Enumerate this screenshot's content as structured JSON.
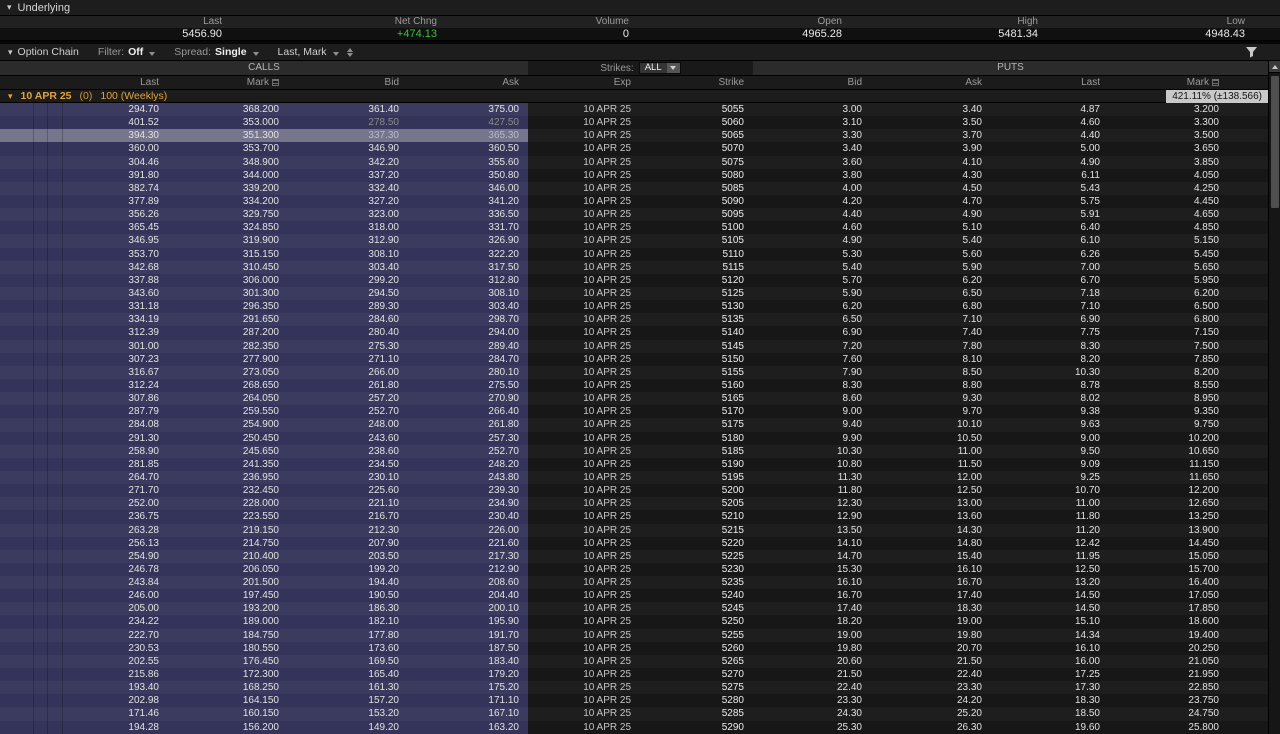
{
  "underlying": {
    "section_label": "Underlying",
    "fields": [
      {
        "label": "Last",
        "value": "5456.90"
      },
      {
        "label": "Net Chng",
        "value": "+474.13"
      },
      {
        "label": "Volume",
        "value": "0"
      },
      {
        "label": "Open",
        "value": "4965.28"
      },
      {
        "label": "High",
        "value": "5481.34"
      },
      {
        "label": "Low",
        "value": "4948.43"
      }
    ]
  },
  "toolbar": {
    "title": "Option Chain",
    "filter_label": "Filter:",
    "filter_value": "Off",
    "spread_label": "Spread:",
    "spread_value": "Single",
    "columns_value": "Last, Mark"
  },
  "chain_header": {
    "calls_label": "CALLS",
    "strikes_label": "Strikes:",
    "strikes_value": "ALL",
    "puts_label": "PUTS"
  },
  "columns": {
    "calls": [
      "Last",
      "Mark",
      "Bid",
      "Ask"
    ],
    "middle": [
      "Exp",
      "Strike"
    ],
    "puts": [
      "Bid",
      "Ask",
      "Last",
      "Mark"
    ]
  },
  "group_row": {
    "expiry": "10 APR 25",
    "days": "(0)",
    "series": "100 (Weeklys)",
    "iv": "421.11% (±138.566)"
  },
  "selected_row_index": 2,
  "stale_row_index": 1,
  "colors": {
    "accent_orange": "#e2a33d",
    "positive_green": "#3fbf3f",
    "calls_itm_bg": "#3b3b60",
    "selected_row_bg": "#75758c",
    "iv_chip_bg": "#c9c9c9"
  },
  "chain_rows": [
    [
      "294.70",
      "368.200",
      "361.40",
      "375.00",
      "10 APR 25",
      "5055",
      "3.00",
      "3.40",
      "4.87",
      "3.200"
    ],
    [
      "401.52",
      "353.000",
      "278.50",
      "427.50",
      "10 APR 25",
      "5060",
      "3.10",
      "3.50",
      "4.60",
      "3.300"
    ],
    [
      "394.30",
      "351.300",
      "337.30",
      "365.30",
      "10 APR 25",
      "5065",
      "3.30",
      "3.70",
      "4.40",
      "3.500"
    ],
    [
      "360.00",
      "353.700",
      "346.90",
      "360.50",
      "10 APR 25",
      "5070",
      "3.40",
      "3.90",
      "5.00",
      "3.650"
    ],
    [
      "304.46",
      "348.900",
      "342.20",
      "355.60",
      "10 APR 25",
      "5075",
      "3.60",
      "4.10",
      "4.90",
      "3.850"
    ],
    [
      "391.80",
      "344.000",
      "337.20",
      "350.80",
      "10 APR 25",
      "5080",
      "3.80",
      "4.30",
      "6.11",
      "4.050"
    ],
    [
      "382.74",
      "339.200",
      "332.40",
      "346.00",
      "10 APR 25",
      "5085",
      "4.00",
      "4.50",
      "5.43",
      "4.250"
    ],
    [
      "377.89",
      "334.200",
      "327.20",
      "341.20",
      "10 APR 25",
      "5090",
      "4.20",
      "4.70",
      "5.75",
      "4.450"
    ],
    [
      "356.26",
      "329.750",
      "323.00",
      "336.50",
      "10 APR 25",
      "5095",
      "4.40",
      "4.90",
      "5.91",
      "4.650"
    ],
    [
      "365.45",
      "324.850",
      "318.00",
      "331.70",
      "10 APR 25",
      "5100",
      "4.60",
      "5.10",
      "6.40",
      "4.850"
    ],
    [
      "346.95",
      "319.900",
      "312.90",
      "326.90",
      "10 APR 25",
      "5105",
      "4.90",
      "5.40",
      "6.10",
      "5.150"
    ],
    [
      "353.70",
      "315.150",
      "308.10",
      "322.20",
      "10 APR 25",
      "5110",
      "5.30",
      "5.60",
      "6.26",
      "5.450"
    ],
    [
      "342.68",
      "310.450",
      "303.40",
      "317.50",
      "10 APR 25",
      "5115",
      "5.40",
      "5.90",
      "7.00",
      "5.650"
    ],
    [
      "337.88",
      "306.000",
      "299.20",
      "312.80",
      "10 APR 25",
      "5120",
      "5.70",
      "6.20",
      "6.70",
      "5.950"
    ],
    [
      "343.60",
      "301.300",
      "294.50",
      "308.10",
      "10 APR 25",
      "5125",
      "5.90",
      "6.50",
      "7.18",
      "6.200"
    ],
    [
      "331.18",
      "296.350",
      "289.30",
      "303.40",
      "10 APR 25",
      "5130",
      "6.20",
      "6.80",
      "7.10",
      "6.500"
    ],
    [
      "334.19",
      "291.650",
      "284.60",
      "298.70",
      "10 APR 25",
      "5135",
      "6.50",
      "7.10",
      "6.90",
      "6.800"
    ],
    [
      "312.39",
      "287.200",
      "280.40",
      "294.00",
      "10 APR 25",
      "5140",
      "6.90",
      "7.40",
      "7.75",
      "7.150"
    ],
    [
      "301.00",
      "282.350",
      "275.30",
      "289.40",
      "10 APR 25",
      "5145",
      "7.20",
      "7.80",
      "8.30",
      "7.500"
    ],
    [
      "307.23",
      "277.900",
      "271.10",
      "284.70",
      "10 APR 25",
      "5150",
      "7.60",
      "8.10",
      "8.20",
      "7.850"
    ],
    [
      "316.67",
      "273.050",
      "266.00",
      "280.10",
      "10 APR 25",
      "5155",
      "7.90",
      "8.50",
      "10.30",
      "8.200"
    ],
    [
      "312.24",
      "268.650",
      "261.80",
      "275.50",
      "10 APR 25",
      "5160",
      "8.30",
      "8.80",
      "8.78",
      "8.550"
    ],
    [
      "307.86",
      "264.050",
      "257.20",
      "270.90",
      "10 APR 25",
      "5165",
      "8.60",
      "9.30",
      "8.02",
      "8.950"
    ],
    [
      "287.79",
      "259.550",
      "252.70",
      "266.40",
      "10 APR 25",
      "5170",
      "9.00",
      "9.70",
      "9.38",
      "9.350"
    ],
    [
      "284.08",
      "254.900",
      "248.00",
      "261.80",
      "10 APR 25",
      "5175",
      "9.40",
      "10.10",
      "9.63",
      "9.750"
    ],
    [
      "291.30",
      "250.450",
      "243.60",
      "257.30",
      "10 APR 25",
      "5180",
      "9.90",
      "10.50",
      "9.00",
      "10.200"
    ],
    [
      "258.90",
      "245.650",
      "238.60",
      "252.70",
      "10 APR 25",
      "5185",
      "10.30",
      "11.00",
      "9.50",
      "10.650"
    ],
    [
      "281.85",
      "241.350",
      "234.50",
      "248.20",
      "10 APR 25",
      "5190",
      "10.80",
      "11.50",
      "9.09",
      "11.150"
    ],
    [
      "264.70",
      "236.950",
      "230.10",
      "243.80",
      "10 APR 25",
      "5195",
      "11.30",
      "12.00",
      "9.25",
      "11.650"
    ],
    [
      "271.70",
      "232.450",
      "225.60",
      "239.30",
      "10 APR 25",
      "5200",
      "11.80",
      "12.50",
      "10.70",
      "12.200"
    ],
    [
      "252.00",
      "228.000",
      "221.10",
      "234.90",
      "10 APR 25",
      "5205",
      "12.30",
      "13.00",
      "11.00",
      "12.650"
    ],
    [
      "236.75",
      "223.550",
      "216.70",
      "230.40",
      "10 APR 25",
      "5210",
      "12.90",
      "13.60",
      "11.80",
      "13.250"
    ],
    [
      "263.28",
      "219.150",
      "212.30",
      "226.00",
      "10 APR 25",
      "5215",
      "13.50",
      "14.30",
      "11.20",
      "13.900"
    ],
    [
      "256.13",
      "214.750",
      "207.90",
      "221.60",
      "10 APR 25",
      "5220",
      "14.10",
      "14.80",
      "12.42",
      "14.450"
    ],
    [
      "254.90",
      "210.400",
      "203.50",
      "217.30",
      "10 APR 25",
      "5225",
      "14.70",
      "15.40",
      "11.95",
      "15.050"
    ],
    [
      "246.78",
      "206.050",
      "199.20",
      "212.90",
      "10 APR 25",
      "5230",
      "15.30",
      "16.10",
      "12.50",
      "15.700"
    ],
    [
      "243.84",
      "201.500",
      "194.40",
      "208.60",
      "10 APR 25",
      "5235",
      "16.10",
      "16.70",
      "13.20",
      "16.400"
    ],
    [
      "246.00",
      "197.450",
      "190.50",
      "204.40",
      "10 APR 25",
      "5240",
      "16.70",
      "17.40",
      "14.50",
      "17.050"
    ],
    [
      "205.00",
      "193.200",
      "186.30",
      "200.10",
      "10 APR 25",
      "5245",
      "17.40",
      "18.30",
      "14.50",
      "17.850"
    ],
    [
      "234.22",
      "189.000",
      "182.10",
      "195.90",
      "10 APR 25",
      "5250",
      "18.20",
      "19.00",
      "15.10",
      "18.600"
    ],
    [
      "222.70",
      "184.750",
      "177.80",
      "191.70",
      "10 APR 25",
      "5255",
      "19.00",
      "19.80",
      "14.34",
      "19.400"
    ],
    [
      "230.53",
      "180.550",
      "173.60",
      "187.50",
      "10 APR 25",
      "5260",
      "19.80",
      "20.70",
      "16.10",
      "20.250"
    ],
    [
      "202.55",
      "176.450",
      "169.50",
      "183.40",
      "10 APR 25",
      "5265",
      "20.60",
      "21.50",
      "16.00",
      "21.050"
    ],
    [
      "215.86",
      "172.300",
      "165.40",
      "179.20",
      "10 APR 25",
      "5270",
      "21.50",
      "22.40",
      "17.25",
      "21.950"
    ],
    [
      "193.40",
      "168.250",
      "161.30",
      "175.20",
      "10 APR 25",
      "5275",
      "22.40",
      "23.30",
      "17.30",
      "22.850"
    ],
    [
      "202.98",
      "164.150",
      "157.20",
      "171.10",
      "10 APR 25",
      "5280",
      "23.30",
      "24.20",
      "18.30",
      "23.750"
    ],
    [
      "171.46",
      "160.150",
      "153.20",
      "167.10",
      "10 APR 25",
      "5285",
      "24.30",
      "25.20",
      "18.50",
      "24.750"
    ],
    [
      "194.28",
      "156.200",
      "149.20",
      "163.20",
      "10 APR 25",
      "5290",
      "25.30",
      "26.30",
      "19.60",
      "25.800"
    ]
  ]
}
